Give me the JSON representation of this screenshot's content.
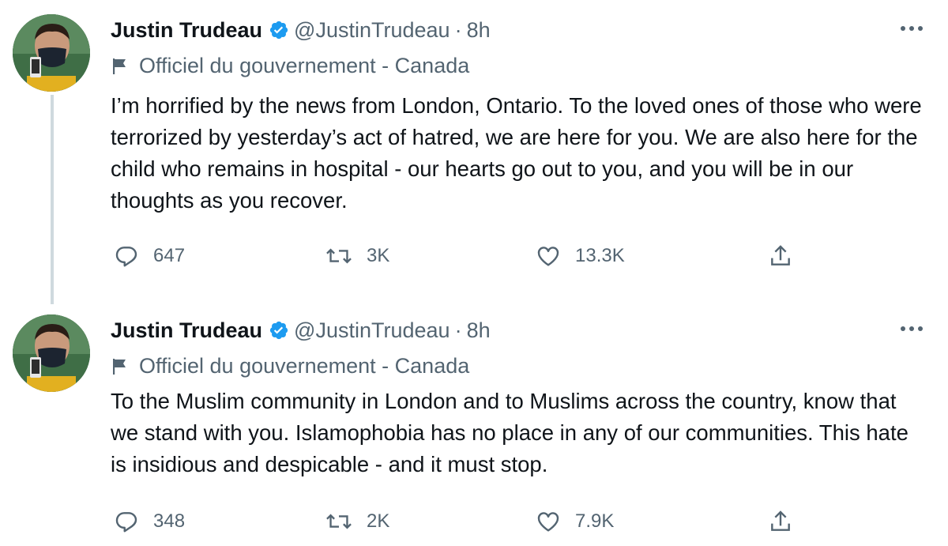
{
  "colors": {
    "text": "#0f1419",
    "secondary": "#536471",
    "verified": "#1d9bf0",
    "thread_line": "#cfd9de"
  },
  "tweets": [
    {
      "author_name": "Justin Trudeau",
      "handle": "@JustinTrudeau",
      "separator": "·",
      "time": "8h",
      "account_label": "Officiel du gouvernement - Canada",
      "text": "I’m horrified by the news from London, Ontario. To the loved ones of those who were terrorized by yesterday’s act of hatred, we are here for you. We are also here for the child who remains in hospital - our hearts go out to you, and you will be in our thoughts as you recover.",
      "replies": "647",
      "retweets": "3K",
      "likes": "13.3K"
    },
    {
      "author_name": "Justin Trudeau",
      "handle": "@JustinTrudeau",
      "separator": "·",
      "time": "8h",
      "account_label": "Officiel du gouvernement - Canada",
      "text": "To the Muslim community in London and to Muslims across the country, know that we stand with you. Islamophobia has no place in any of our communities. This hate is insidious and despicable - and it must stop.",
      "replies": "348",
      "retweets": "2K",
      "likes": "7.9K"
    }
  ],
  "icons": {
    "verified": "verified-badge-icon",
    "more": "more-options-icon",
    "flag": "government-flag-icon",
    "reply": "reply-icon",
    "retweet": "retweet-icon",
    "like": "like-icon",
    "share": "share-icon"
  }
}
